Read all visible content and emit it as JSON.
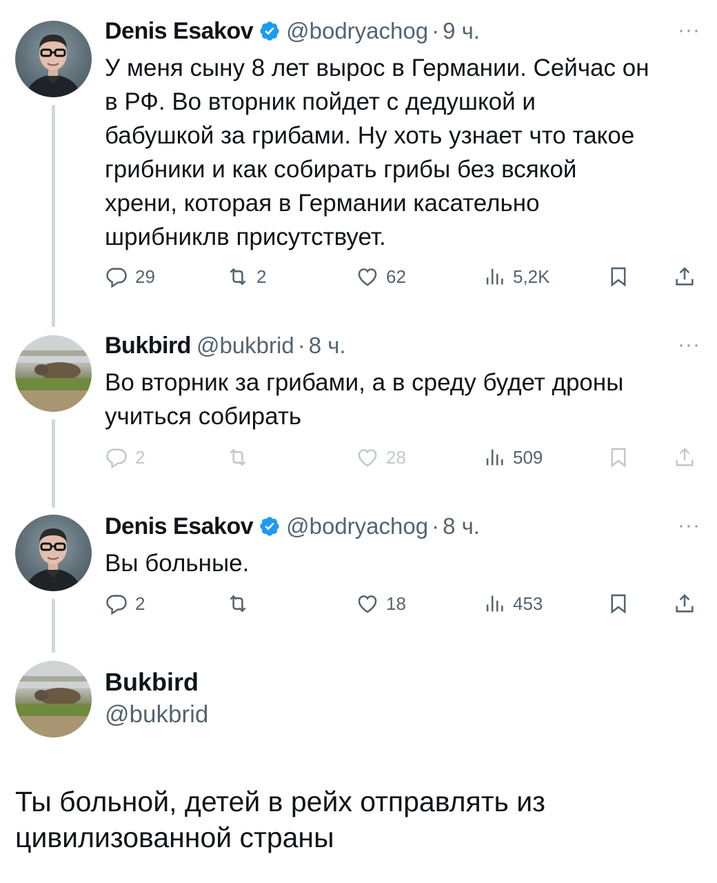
{
  "tweets": [
    {
      "name": "Denis Esakov",
      "verified": true,
      "handle": "@bodryachog",
      "time": "9 ч.",
      "text": "У меня сыну 8 лет вырос в Германии. Сейчас он\nв РФ. Во вторник пойдет с дедушкой и\nбабушкой за грибами. Ну хоть узнает что такое\nгрибники и как собирать грибы без всякой\nхрени, которая в Германии касательно\nшрибниклв присутствует.",
      "replies": "29",
      "reposts": "2",
      "likes": "62",
      "views": "5,2K"
    },
    {
      "name": "Bukbird",
      "handle": "@bukbrid",
      "time": "8 ч.",
      "text": "Во вторник за грибами, а в среду будет дроны\nучиться собирать",
      "replies": "2",
      "reposts": "",
      "likes": "28",
      "views": "509"
    },
    {
      "name": "Denis Esakov",
      "verified": true,
      "handle": "@bodryachog",
      "time": "8 ч.",
      "text": "Вы больные.",
      "replies": "2",
      "reposts": "",
      "likes": "18",
      "views": "453"
    }
  ],
  "reply": {
    "name": "Bukbird",
    "handle": "@bukbrid",
    "text": "Ты больной, детей в рейх отправлять из\nцивилизованной страны"
  },
  "ui": {
    "separator": "·",
    "more": "···"
  },
  "colors": {
    "verified": "#1d9bf0",
    "secondary_text": "#536471",
    "thread_line": "#cfd9de"
  }
}
